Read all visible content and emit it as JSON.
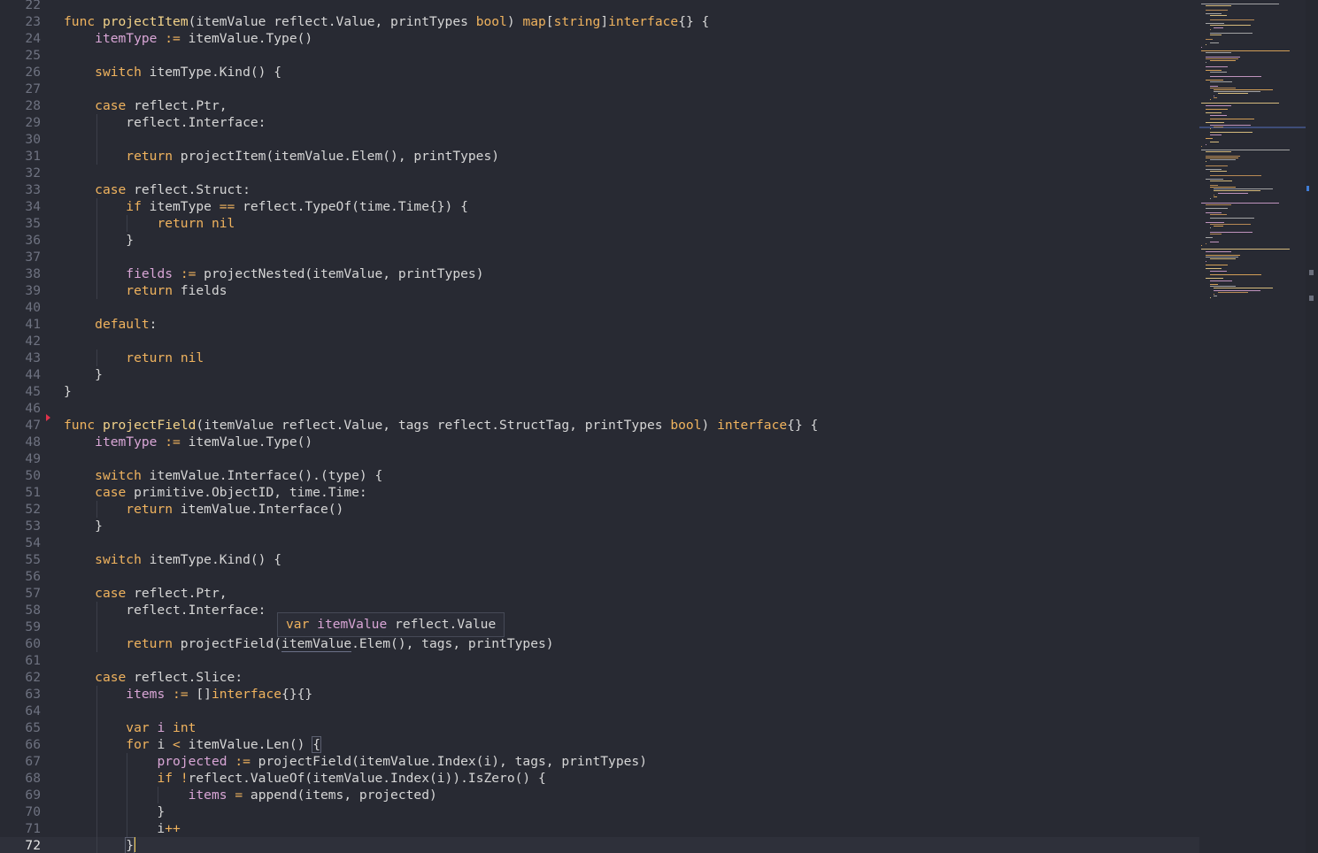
{
  "editor": {
    "current_line": "72",
    "lines": [
      {
        "n": "22",
        "html": ""
      },
      {
        "n": "23",
        "html": "<span class=\"kw\">func</span> <span class=\"fn\">projectItem</span>(itemValue reflect.Value, printTypes <span class=\"kw\">bool</span>) <span class=\"kw\">map</span>[<span class=\"kw\">string</span>]<span class=\"kw\">interface</span>{} {"
      },
      {
        "n": "24",
        "html": "    <span class=\"var\">itemType</span> <span class=\"op\">:=</span> itemValue.Type()"
      },
      {
        "n": "25",
        "html": ""
      },
      {
        "n": "26",
        "html": "    <span class=\"kw\">switch</span> itemType.Kind() {"
      },
      {
        "n": "27",
        "html": ""
      },
      {
        "n": "28",
        "html": "    <span class=\"kw\">case</span> reflect.Ptr,"
      },
      {
        "n": "29",
        "html": "        reflect.Interface:"
      },
      {
        "n": "30",
        "html": ""
      },
      {
        "n": "31",
        "html": "        <span class=\"kw\">return</span> projectItem(itemValue.Elem(), printTypes)"
      },
      {
        "n": "32",
        "html": ""
      },
      {
        "n": "33",
        "html": "    <span class=\"kw\">case</span> reflect.Struct:"
      },
      {
        "n": "34",
        "html": "        <span class=\"kw\">if</span> itemType <span class=\"op\">==</span> reflect.TypeOf(time.Time{}) {"
      },
      {
        "n": "35",
        "html": "            <span class=\"kw\">return</span> <span class=\"lit\">nil</span>"
      },
      {
        "n": "36",
        "html": "        }"
      },
      {
        "n": "37",
        "html": ""
      },
      {
        "n": "38",
        "html": "        <span class=\"var\">fields</span> <span class=\"op\">:=</span> projectNested(itemValue, printTypes)"
      },
      {
        "n": "39",
        "html": "        <span class=\"kw\">return</span> fields"
      },
      {
        "n": "40",
        "html": ""
      },
      {
        "n": "41",
        "html": "    <span class=\"kw\">default</span>:"
      },
      {
        "n": "42",
        "html": ""
      },
      {
        "n": "43",
        "html": "        <span class=\"kw\">return</span> <span class=\"lit\">nil</span>"
      },
      {
        "n": "44",
        "html": "    }"
      },
      {
        "n": "45",
        "html": "}"
      },
      {
        "n": "46",
        "html": ""
      },
      {
        "n": "47",
        "html": "<span class=\"kw\">func</span> <span class=\"fn\">projectField</span>(itemValue reflect.Value, tags reflect.StructTag, printTypes <span class=\"kw\">bool</span>) <span class=\"kw\">interface</span>{} {"
      },
      {
        "n": "48",
        "html": "    <span class=\"var\">itemType</span> <span class=\"op\">:=</span> itemValue.Type()"
      },
      {
        "n": "49",
        "html": ""
      },
      {
        "n": "50",
        "html": "    <span class=\"kw\">switch</span> itemValue.Interface().(type) {"
      },
      {
        "n": "51",
        "html": "    <span class=\"kw\">case</span> primitive.ObjectID, time.Time:"
      },
      {
        "n": "52",
        "html": "        <span class=\"kw\">return</span> itemValue.Interface()"
      },
      {
        "n": "53",
        "html": "    }"
      },
      {
        "n": "54",
        "html": ""
      },
      {
        "n": "55",
        "html": "    <span class=\"kw\">switch</span> itemType.Kind() {"
      },
      {
        "n": "56",
        "html": ""
      },
      {
        "n": "57",
        "html": "    <span class=\"kw\">case</span> reflect.Ptr,"
      },
      {
        "n": "58",
        "html": "        reflect.Interface:"
      },
      {
        "n": "59",
        "html": ""
      },
      {
        "n": "60",
        "html": "        <span class=\"kw\">return</span> projectField(<span class=\"hl\">itemValue</span>.Elem(), tags, printTypes)"
      },
      {
        "n": "61",
        "html": ""
      },
      {
        "n": "62",
        "html": "    <span class=\"kw\">case</span> reflect.Slice:"
      },
      {
        "n": "63",
        "html": "        <span class=\"var\">items</span> <span class=\"op\">:=</span> []<span class=\"kw\">interface</span>{}{}"
      },
      {
        "n": "64",
        "html": ""
      },
      {
        "n": "65",
        "html": "        <span class=\"kw\">var</span> <span class=\"var\">i</span> <span class=\"kw\">int</span>"
      },
      {
        "n": "66",
        "html": "        <span class=\"kw\">for</span> i <span class=\"op\">&lt;</span> itemValue.Len() <span class=\"brk\">{</span>"
      },
      {
        "n": "67",
        "html": "            <span class=\"var\">projected</span> <span class=\"op\">:=</span> projectField(itemValue.Index(i), tags, printTypes)"
      },
      {
        "n": "68",
        "html": "            <span class=\"kw\">if</span> <span class=\"op\">!</span>reflect.ValueOf(itemValue.Index(i)).IsZero() {"
      },
      {
        "n": "69",
        "html": "                <span class=\"var\">items</span> <span class=\"op\">=</span> append(items, projected)"
      },
      {
        "n": "70",
        "html": "            }"
      },
      {
        "n": "71",
        "html": "            i<span class=\"op\">++</span>"
      },
      {
        "n": "72",
        "html": "        <span class=\"brk\">}</span><span class=\"caret\"></span>"
      }
    ]
  },
  "tooltip": {
    "keyword": "var",
    "name": "itemValue",
    "type": "reflect.Value"
  },
  "colors": {
    "background": "#282a33",
    "keyword": "#f0b35e",
    "function": "#f3d38a",
    "variable": "#d9a6d6",
    "line_number": "#6e7280",
    "error_marker": "#e0324b",
    "caret": "#f2c94c"
  }
}
